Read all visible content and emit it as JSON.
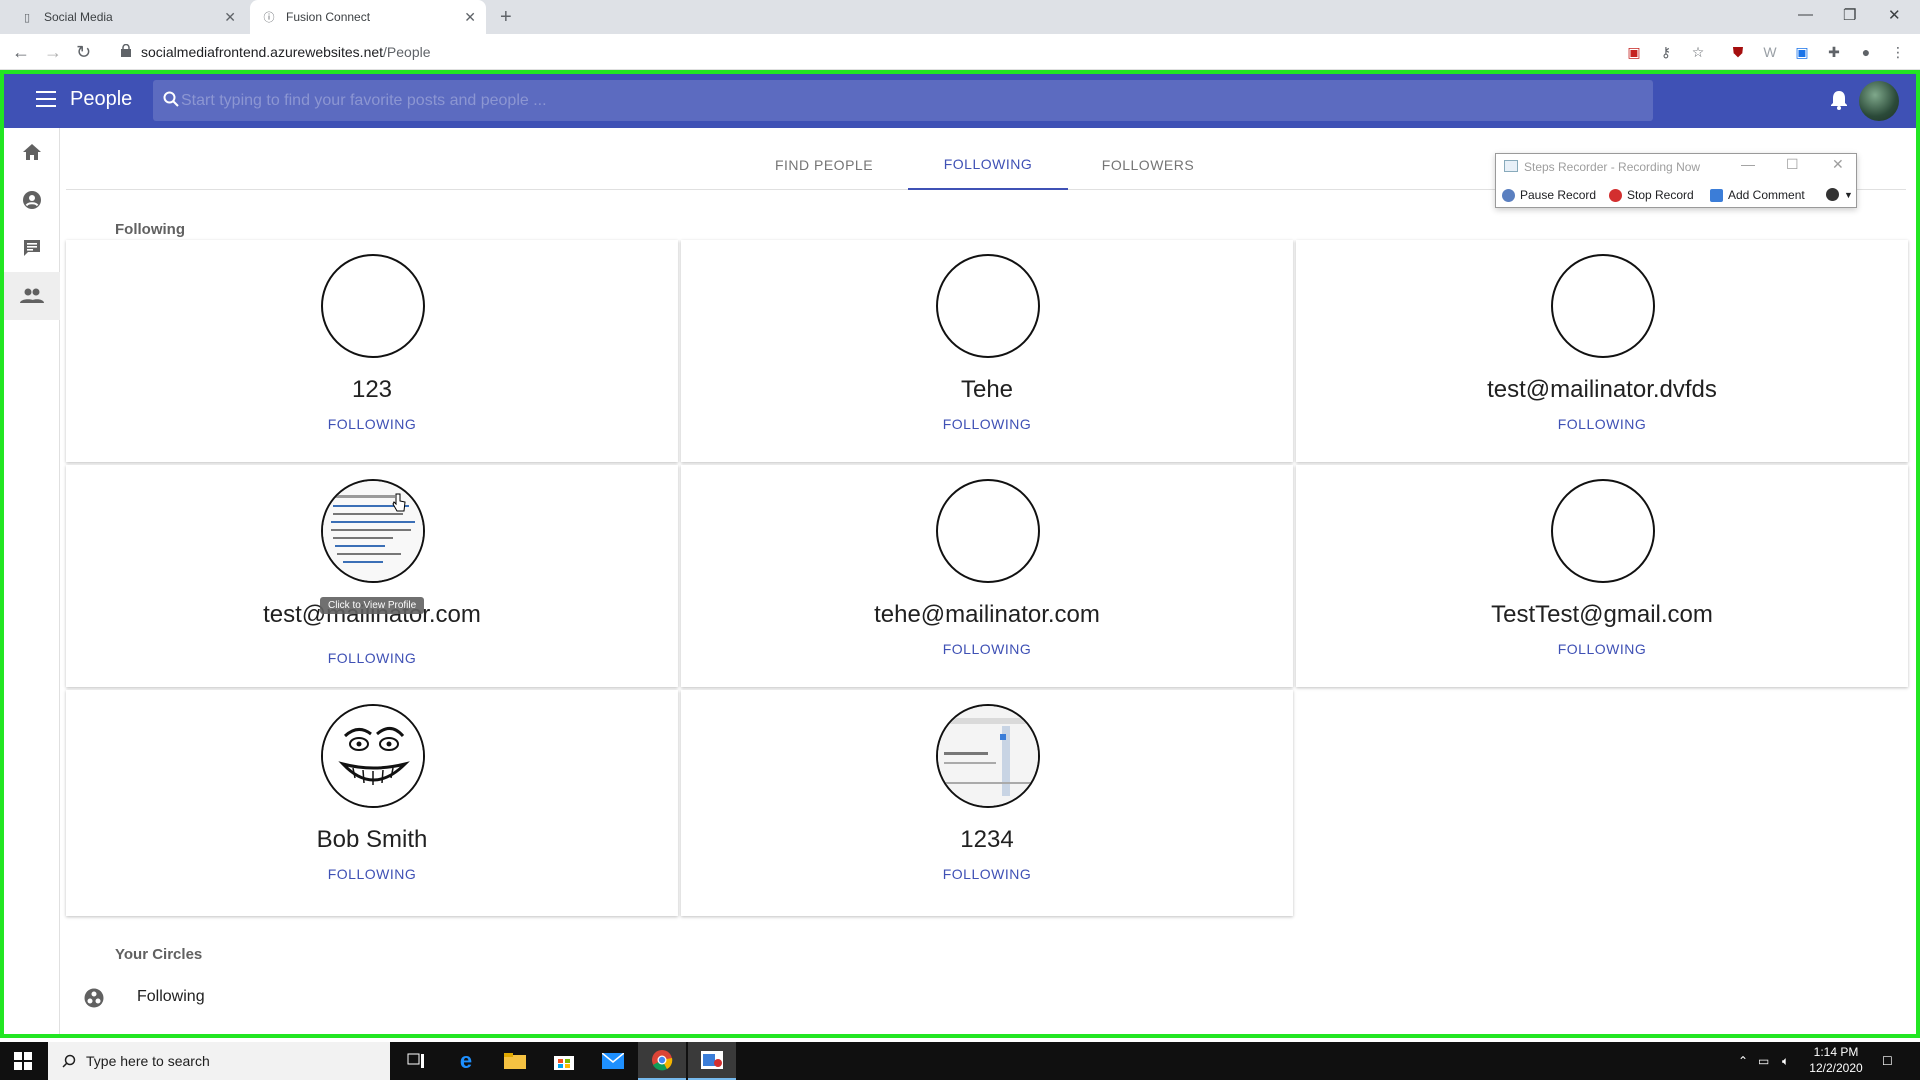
{
  "browser": {
    "tabs": [
      {
        "title": "Social Media"
      },
      {
        "title": "Fusion Connect"
      }
    ],
    "url_host": "socialmediafrontend.azurewebsites.net",
    "url_path": "/People"
  },
  "appbar": {
    "title": "People",
    "search_placeholder": "Start typing to find your favorite posts and people ..."
  },
  "page_tabs": [
    {
      "label": "FIND PEOPLE",
      "active": false
    },
    {
      "label": "FOLLOWING",
      "active": true
    },
    {
      "label": "FOLLOWERS",
      "active": false
    }
  ],
  "following_section": {
    "title": "Following",
    "people": [
      {
        "name": "123",
        "button": "FOLLOWING",
        "avatar": "empty"
      },
      {
        "name": "Tehe",
        "button": "FOLLOWING",
        "avatar": "empty"
      },
      {
        "name": "test@mailinator.dvfds",
        "button": "FOLLOWING",
        "avatar": "empty"
      },
      {
        "name": "test@mailinator.com",
        "button": "FOLLOWING",
        "avatar": "screenshot-thumbnail"
      },
      {
        "name": "tehe@mailinator.com",
        "button": "FOLLOWING",
        "avatar": "empty"
      },
      {
        "name": "TestTest@gmail.com",
        "button": "FOLLOWING",
        "avatar": "empty"
      },
      {
        "name": "Bob Smith",
        "button": "FOLLOWING",
        "avatar": "meme-face"
      },
      {
        "name": "1234",
        "button": "FOLLOWING",
        "avatar": "screenshot-thumbnail"
      }
    ],
    "tooltip": "Click to View Profile"
  },
  "circles_section": {
    "title": "Your Circles",
    "items": [
      {
        "label": "Following",
        "icon": "circles-icon"
      }
    ]
  },
  "steps_recorder": {
    "title": "Steps Recorder - Recording Now",
    "pause": "Pause Record",
    "stop": "Stop Record",
    "comment": "Add Comment"
  },
  "taskbar": {
    "search_placeholder": "Type here to search",
    "time": "1:14 PM",
    "date": "12/2/2020"
  },
  "colors": {
    "primary": "#3f51b5",
    "search_bg": "#5c6bc0",
    "recording_frame": "#22e622"
  }
}
